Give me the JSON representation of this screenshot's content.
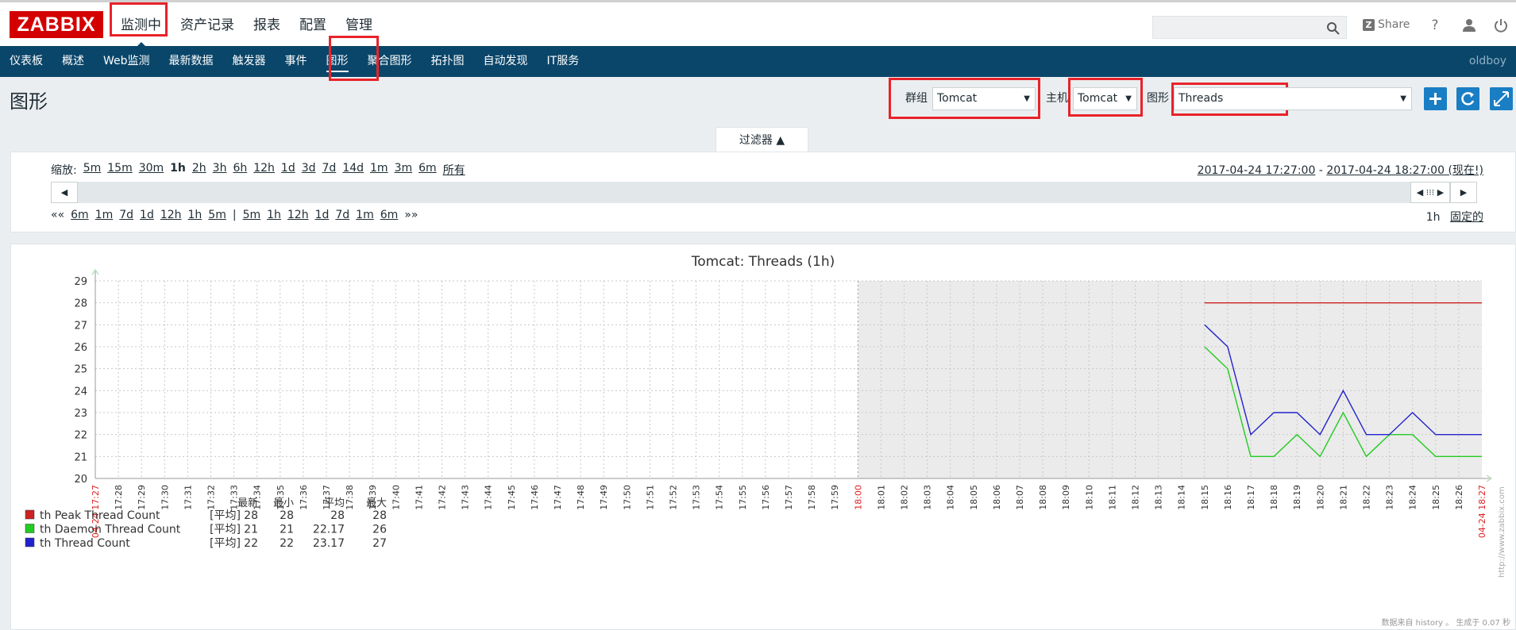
{
  "header": {
    "logo": "ZABBIX",
    "menu": [
      "监测中",
      "资产记录",
      "报表",
      "配置",
      "管理"
    ],
    "share_label": "Share",
    "help_icon": "?"
  },
  "submenu": {
    "items": [
      "仪表板",
      "概述",
      "Web监测",
      "最新数据",
      "触发器",
      "事件",
      "图形",
      "聚合图形",
      "拓扑图",
      "自动发现",
      "IT服务"
    ],
    "user": "oldboy"
  },
  "page": {
    "title": "图形",
    "group_label": "群组",
    "group_value": "Tomcat",
    "host_label": "主机",
    "host_value": "Tomcat",
    "graph_label": "图形",
    "graph_value": "Threads"
  },
  "filter": {
    "tab_label": "过滤器 ▲",
    "zoom_label": "缩放:",
    "zoom_options": [
      "5m",
      "15m",
      "30m",
      "1h",
      "2h",
      "3h",
      "6h",
      "12h",
      "1d",
      "3d",
      "7d",
      "14d",
      "1m",
      "3m",
      "6m",
      "所有"
    ],
    "zoom_selected": "1h",
    "range_from": "2017-04-24 17:27:00",
    "range_sep": " - ",
    "range_to": "2017-04-24 18:27:00 (现在!)",
    "nav_back": [
      "««",
      "6m",
      "1m",
      "7d",
      "1d",
      "12h",
      "1h",
      "5m"
    ],
    "nav_sep": "|",
    "nav_fwd": [
      "5m",
      "1h",
      "12h",
      "1d",
      "7d",
      "1m",
      "6m",
      "»»"
    ],
    "period_value": "1h",
    "period_fixed": "固定的"
  },
  "chart_data": {
    "type": "line",
    "title": "Tomcat: Threads (1h)",
    "ylim": [
      20,
      29
    ],
    "y_ticks": [
      20,
      21,
      22,
      23,
      24,
      25,
      26,
      27,
      28,
      29
    ],
    "x_start_label": "04-24 17:27",
    "x_end_label": "04-24 18:27",
    "x_ticks": [
      "17:28",
      "17:29",
      "17:30",
      "17:31",
      "17:32",
      "17:33",
      "17:34",
      "17:35",
      "17:36",
      "17:37",
      "17:38",
      "17:39",
      "17:40",
      "17:41",
      "17:42",
      "17:43",
      "17:44",
      "17:45",
      "17:46",
      "17:47",
      "17:48",
      "17:49",
      "17:50",
      "17:51",
      "17:52",
      "17:53",
      "17:54",
      "17:55",
      "17:56",
      "17:57",
      "17:58",
      "17:59",
      "18:00",
      "18:01",
      "18:02",
      "18:03",
      "18:04",
      "18:05",
      "18:06",
      "18:07",
      "18:08",
      "18:09",
      "18:10",
      "18:11",
      "18:12",
      "18:13",
      "18:14",
      "18:15",
      "18:16",
      "18:17",
      "18:18",
      "18:19",
      "18:20",
      "18:21",
      "18:22",
      "18:23",
      "18:24",
      "18:25",
      "18:26"
    ],
    "highlight_tick": "18:00",
    "series": [
      {
        "name": "th Peak Thread Count",
        "color": "#cc2222",
        "x": [
          "18:15",
          "18:16",
          "18:17",
          "18:18",
          "18:19",
          "18:20",
          "18:21",
          "18:22",
          "18:23",
          "18:24",
          "18:25",
          "18:26",
          "18:27"
        ],
        "values": [
          28,
          28,
          28,
          28,
          28,
          28,
          28,
          28,
          28,
          28,
          28,
          28,
          28
        ]
      },
      {
        "name": "th Daemon Thread Count",
        "color": "#22cc22",
        "x": [
          "18:15",
          "18:16",
          "18:17",
          "18:18",
          "18:19",
          "18:20",
          "18:21",
          "18:22",
          "18:23",
          "18:24",
          "18:25",
          "18:26",
          "18:27"
        ],
        "values": [
          26,
          25,
          21,
          21,
          22,
          21,
          23,
          21,
          22,
          22,
          21,
          21,
          21
        ]
      },
      {
        "name": "th Thread Count",
        "color": "#2222cc",
        "x": [
          "18:15",
          "18:16",
          "18:17",
          "18:18",
          "18:19",
          "18:20",
          "18:21",
          "18:22",
          "18:23",
          "18:24",
          "18:25",
          "18:26",
          "18:27"
        ],
        "values": [
          27,
          26,
          22,
          23,
          23,
          22,
          24,
          22,
          22,
          23,
          22,
          22,
          22
        ]
      }
    ],
    "legend": {
      "headers": [
        "最新",
        "最小",
        "平均",
        "最大"
      ],
      "func_label": "[平均]",
      "rows": [
        {
          "name": "th Peak Thread Count",
          "color": "#cc2222",
          "last": "28",
          "min": "28",
          "avg": "28",
          "max": "28"
        },
        {
          "name": "th Daemon Thread Count",
          "color": "#22cc22",
          "last": "21",
          "min": "21",
          "avg": "22.17",
          "max": "26"
        },
        {
          "name": "th Thread Count",
          "color": "#2222cc",
          "last": "22",
          "min": "22",
          "avg": "23.17",
          "max": "27"
        }
      ]
    },
    "watermark": "http://www.zabbix.com",
    "footer": "数据来自 history 。 生成于 0.07 秒"
  }
}
